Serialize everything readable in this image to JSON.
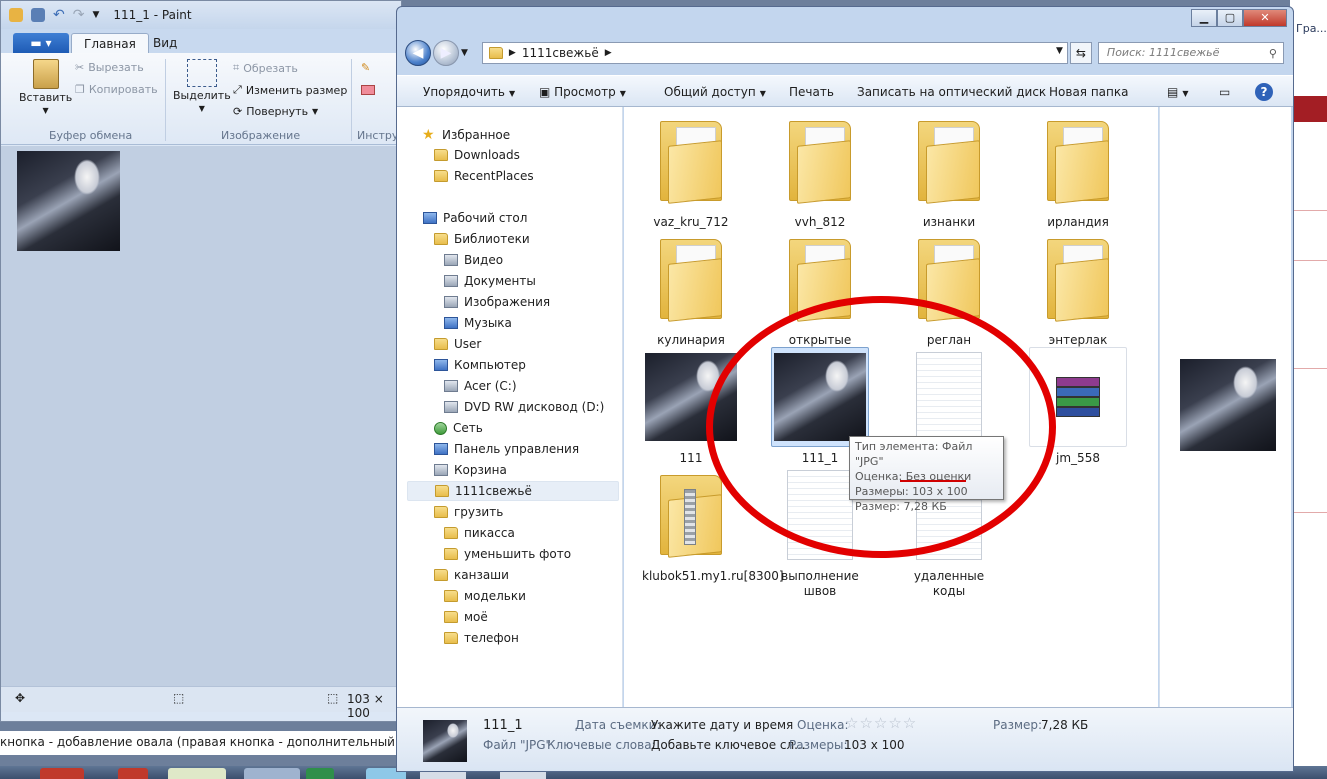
{
  "paint": {
    "title": "111_1 - Paint",
    "tabs": [
      "Главная",
      "Вид"
    ],
    "clipboard": {
      "paste": "Вставить",
      "cut": "Вырезать",
      "copy": "Копировать",
      "group": "Буфер обмена"
    },
    "image": {
      "select": "Выделить",
      "crop": "Обрезать",
      "resize": "Изменить размер",
      "rotate": "Повернуть",
      "group": "Изображение"
    },
    "tools_group": "Инстру",
    "status_size": "103 × 100",
    "status_move_icon": "move-icon",
    "status_select_icon": "selection-icon"
  },
  "bottom_text": "кнопка - добавление овала (правая кнопка - дополнительный цвет). Кру",
  "background": {
    "right_title": "Гра..."
  },
  "explorer": {
    "breadcrumb": "1111свежьё",
    "search_placeholder": "Поиск: 1111свежьё",
    "toolbar": [
      "Упорядочить",
      "Просмотр",
      "Общий доступ",
      "Печать",
      "Записать на оптический диск",
      "Новая папка"
    ],
    "nav": [
      {
        "label": "Избранное",
        "icon": "star"
      },
      {
        "label": "Downloads",
        "icon": "folder"
      },
      {
        "label": "RecentPlaces",
        "icon": "folder"
      },
      {
        "label": "Рабочий стол",
        "icon": "blue"
      },
      {
        "label": "Библиотеки",
        "icon": "folder"
      },
      {
        "label": "Видео",
        "icon": "gray"
      },
      {
        "label": "Документы",
        "icon": "gray"
      },
      {
        "label": "Изображения",
        "icon": "gray"
      },
      {
        "label": "Музыка",
        "icon": "blue"
      },
      {
        "label": "User",
        "icon": "folder"
      },
      {
        "label": "Компьютер",
        "icon": "blue"
      },
      {
        "label": "Acer (C:)",
        "icon": "gray"
      },
      {
        "label": "DVD RW дисковод (D:)",
        "icon": "gray"
      },
      {
        "label": "Сеть",
        "icon": "green"
      },
      {
        "label": "Панель управления",
        "icon": "blue"
      },
      {
        "label": "Корзина",
        "icon": "gray"
      },
      {
        "label": "1111свежьё",
        "icon": "folder"
      },
      {
        "label": "грузить",
        "icon": "folder"
      },
      {
        "label": "пикасса",
        "icon": "folder"
      },
      {
        "label": "уменьшить фото",
        "icon": "folder"
      },
      {
        "label": "канзаши",
        "icon": "folder"
      },
      {
        "label": "модельки",
        "icon": "folder"
      },
      {
        "label": "моё",
        "icon": "folder"
      },
      {
        "label": "телефон",
        "icon": "folder"
      }
    ],
    "files": [
      {
        "name": "vaz_kru_712",
        "kind": "folder"
      },
      {
        "name": "vvh_812",
        "kind": "folder"
      },
      {
        "name": "изнанки",
        "kind": "folder"
      },
      {
        "name": "ирландия",
        "kind": "folder"
      },
      {
        "name": "кулинария",
        "kind": "folder"
      },
      {
        "name": "открытые",
        "kind": "folder"
      },
      {
        "name": "реглан",
        "kind": "folder"
      },
      {
        "name": "энтерлак",
        "kind": "folder"
      },
      {
        "name": "111",
        "kind": "photo"
      },
      {
        "name": "111_1",
        "kind": "photo"
      },
      {
        "name": "",
        "kind": "doc"
      },
      {
        "name": "jm_558",
        "kind": "rar"
      },
      {
        "name": "klubok51.my1.ru[8300]",
        "kind": "zipfolder"
      },
      {
        "name": "выполнение швов",
        "kind": "doc"
      },
      {
        "name": "удаленные коды",
        "kind": "doc"
      }
    ],
    "tooltip": {
      "line1": "Тип элемента: Файл \"JPG\"",
      "line2": "Оценка: Без оценки",
      "line3_label": "Размеры: ",
      "line3_value": "103 x 100",
      "line4": "Размер: 7,28 КБ"
    },
    "details": {
      "name": "111_1",
      "type": "Файл \"JPG\"",
      "date_label": "Дата съемки:",
      "date_value": "Укажите дату и время",
      "rating_label": "Оценка:",
      "keywords_label": "Ключевые слова:",
      "keywords_value": "Добавьте ключевое сл...",
      "size_label": "Размер:",
      "size_value": "7,28 КБ",
      "dims_label": "Размеры:",
      "dims_value": "103 x 100"
    }
  }
}
